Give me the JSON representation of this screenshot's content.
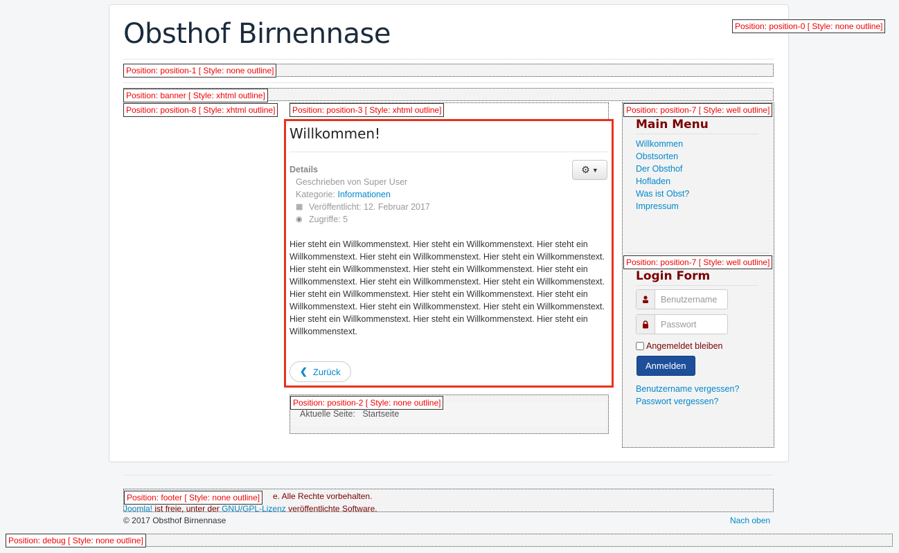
{
  "site": {
    "title": "Obsthof Birnennase"
  },
  "positions": {
    "position0": "Position: position-0 [ Style: none outline]",
    "position1": "Position: position-1 [ Style: none outline]",
    "banner": "Position: banner [ Style: xhtml outline]",
    "position8": "Position: position-8 [ Style: xhtml outline]",
    "position3": "Position: position-3 [ Style: xhtml outline]",
    "position7a": "Position: position-7 [ Style: well outline]",
    "position7b": "Position: position-7 [ Style: well outline]",
    "position2": "Position: position-2 [ Style: none outline]",
    "footer": "Position: footer [ Style: none outline]",
    "debug": "Position: debug [ Style: none outline]"
  },
  "article": {
    "title": "Willkommen!",
    "details_label": "Details",
    "author": "Geschrieben von Super User",
    "category_label": "Kategorie: ",
    "category_value": "Informationen",
    "published": "Veröffentlicht: 12. Februar 2017",
    "hits": "Zugriffe: 5",
    "body": "Hier steht ein Willkommenstext. Hier steht ein Willkommenstext. Hier steht ein Willkommenstext. Hier steht ein Willkommenstext. Hier steht ein Willkommenstext. Hier steht ein Willkommenstext. Hier steht ein Willkommenstext. Hier steht ein Willkommenstext. Hier steht ein Willkommenstext. Hier steht ein Willkommenstext. Hier steht ein Willkommenstext. Hier steht ein Willkommenstext. Hier steht ein Willkommenstext. Hier steht ein Willkommenstext. Hier steht ein Willkommenstext. Hier steht ein Willkommenstext. Hier steht ein Willkommenstext. Hier steht ein Willkommenstext.",
    "back_label": "Zurück"
  },
  "breadcrumb": {
    "label": "Aktuelle Seite:",
    "current": "Startseite"
  },
  "main_menu": {
    "title": "Main Menu",
    "items": [
      "Willkommen",
      "Obstsorten",
      "Der Obsthof",
      "Hofladen",
      "Was ist Obst?",
      "Impressum"
    ]
  },
  "login": {
    "title": "Login Form",
    "username_placeholder": "Benutzername",
    "password_placeholder": "Passwort",
    "remember_label": "Angemeldet bleiben",
    "submit_label": "Anmelden",
    "forgot_username": "Benutzername vergessen?",
    "forgot_password": "Passwort vergessen?"
  },
  "footer": {
    "rights_tail": "e. Alle Rechte vorbehalten.",
    "joomla_link": "Joomla!",
    "license_pre": " ist freie, unter der ",
    "license_link": "GNU/GPL-Lizenz",
    "license_post": " veröffentlichte Software.",
    "copyright": "© 2017 Obsthof Birnennase",
    "back_to_top": "Nach oben"
  },
  "colors": {
    "accent_red": "#e8321b",
    "link": "#0088cc",
    "title_red": "#7a0000",
    "button_blue": "#1d4f9b"
  }
}
